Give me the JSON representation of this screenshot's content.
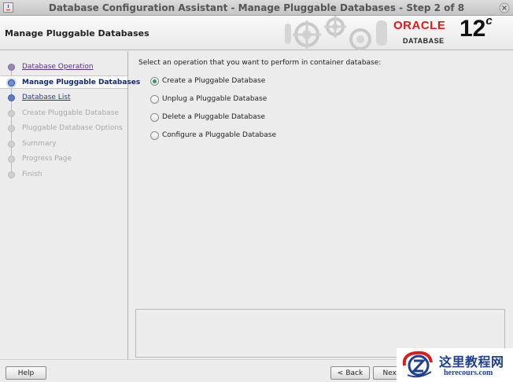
{
  "window": {
    "title": "Database Configuration Assistant - Manage Pluggable Databases - Step 2 of 8"
  },
  "header": {
    "page_title": "Manage Pluggable Databases",
    "brand_word": "ORACLE",
    "brand_sub": "DATABASE",
    "version": "12",
    "version_suffix": "c"
  },
  "steps": [
    {
      "label": "Database Operation",
      "state": "done"
    },
    {
      "label": "Manage Pluggable Databases",
      "state": "current"
    },
    {
      "label": "Database List",
      "state": "link"
    },
    {
      "label": "Create Pluggable Database",
      "state": "disabled"
    },
    {
      "label": "Pluggable Database Options",
      "state": "disabled"
    },
    {
      "label": "Summary",
      "state": "disabled"
    },
    {
      "label": "Progress Page",
      "state": "disabled"
    },
    {
      "label": "Finish",
      "state": "disabled"
    }
  ],
  "main": {
    "prompt": "Select an operation that you want to perform in container database:",
    "options": [
      {
        "label": "Create a Pluggable Database",
        "checked": true
      },
      {
        "label": "Unplug a Pluggable Database",
        "checked": false
      },
      {
        "label": "Delete a Pluggable Database",
        "checked": false
      },
      {
        "label": "Configure a Pluggable Database",
        "checked": false
      }
    ]
  },
  "buttons": {
    "help": "Help",
    "back": "Back",
    "next": "Next"
  },
  "watermark": {
    "text_cn": "这里教程网",
    "url": "herecours.com"
  },
  "colors": {
    "accent_selected": "#2d9a66",
    "link": "#1c3b8f",
    "visited": "#5a2d82",
    "oracle_red": "#e01a1a"
  }
}
